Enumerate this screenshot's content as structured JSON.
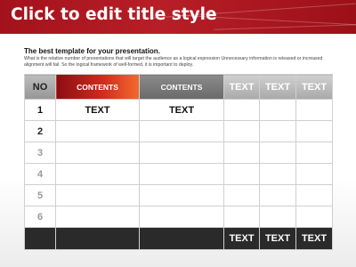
{
  "title": "Click to edit title style",
  "subtitle": "The best template for your presentation.",
  "description": "What is the relative number of presentations that will target the audience as a logical expression Unnecessary information is released or increased alignment will fail. So the logical framework of well-formed, it is important to deploy.",
  "table": {
    "headers": [
      "NO",
      "CONTENTS",
      "CONTENTS",
      "TEXT",
      "TEXT",
      "TEXT"
    ],
    "rows": [
      {
        "no": "1",
        "cells": [
          "TEXT",
          "TEXT",
          "",
          "",
          ""
        ]
      },
      {
        "no": "2",
        "cells": [
          "",
          "",
          "",
          "",
          ""
        ]
      },
      {
        "no": "3",
        "cells": [
          "",
          "",
          "",
          "",
          ""
        ]
      },
      {
        "no": "4",
        "cells": [
          "",
          "",
          "",
          "",
          ""
        ]
      },
      {
        "no": "5",
        "cells": [
          "",
          "",
          "",
          "",
          ""
        ]
      },
      {
        "no": "6",
        "cells": [
          "",
          "",
          "",
          "",
          ""
        ]
      }
    ],
    "footer": [
      "",
      "",
      "",
      "TEXT",
      "TEXT",
      "TEXT"
    ]
  },
  "colors": {
    "title_bar": "#a3121c",
    "contents_header_accent": "#d02a1c",
    "footer_bar": "#2a2a2a",
    "row_number_1": "#111111",
    "row_number_other": "#9a9a9a"
  }
}
